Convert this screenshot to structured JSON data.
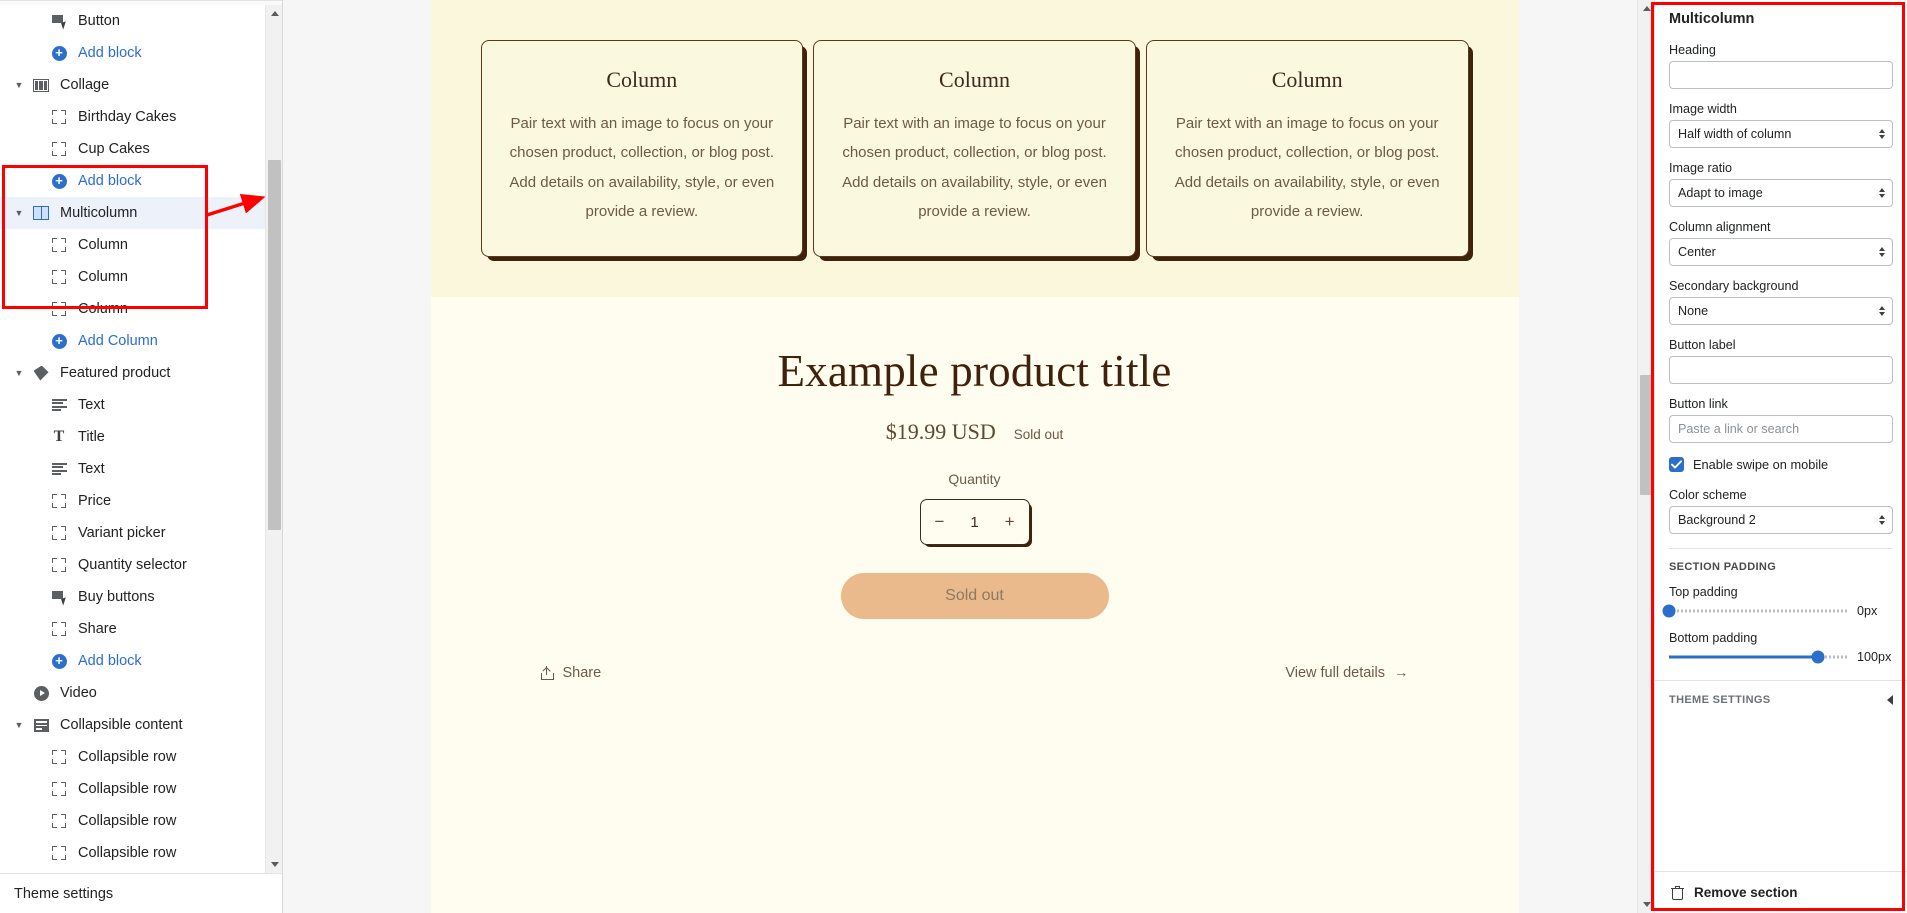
{
  "sidebar": {
    "tree": [
      {
        "label": "Button",
        "icon": "cursor-icon",
        "indent": 1,
        "caret": false,
        "type": "block"
      },
      {
        "label": "Add block",
        "icon": "plus-circle-icon",
        "indent": 1,
        "caret": false,
        "type": "action"
      },
      {
        "label": "Collage",
        "icon": "collage-icon",
        "indent": 0,
        "caret": true,
        "type": "section"
      },
      {
        "label": "Birthday Cakes",
        "icon": "block-icon",
        "indent": 1,
        "caret": false,
        "type": "block"
      },
      {
        "label": "Cup Cakes",
        "icon": "block-icon",
        "indent": 1,
        "caret": false,
        "type": "block"
      },
      {
        "label": "Add block",
        "icon": "plus-circle-icon",
        "indent": 1,
        "caret": false,
        "type": "action"
      },
      {
        "label": "Multicolumn",
        "icon": "multicolumn-icon",
        "indent": 0,
        "caret": true,
        "type": "section",
        "selected": true
      },
      {
        "label": "Column",
        "icon": "block-icon",
        "indent": 1,
        "caret": false,
        "type": "block"
      },
      {
        "label": "Column",
        "icon": "block-icon",
        "indent": 1,
        "caret": false,
        "type": "block"
      },
      {
        "label": "Column",
        "icon": "block-icon",
        "indent": 1,
        "caret": false,
        "type": "block"
      },
      {
        "label": "Add Column",
        "icon": "plus-circle-icon",
        "indent": 1,
        "caret": false,
        "type": "action"
      },
      {
        "label": "Featured product",
        "icon": "tag-icon",
        "indent": 0,
        "caret": true,
        "type": "section"
      },
      {
        "label": "Text",
        "icon": "text-icon",
        "indent": 1,
        "caret": false,
        "type": "block"
      },
      {
        "label": "Title",
        "icon": "title-icon",
        "indent": 1,
        "caret": false,
        "type": "block"
      },
      {
        "label": "Text",
        "icon": "text-icon",
        "indent": 1,
        "caret": false,
        "type": "block"
      },
      {
        "label": "Price",
        "icon": "block-icon",
        "indent": 1,
        "caret": false,
        "type": "block"
      },
      {
        "label": "Variant picker",
        "icon": "block-icon",
        "indent": 1,
        "caret": false,
        "type": "block"
      },
      {
        "label": "Quantity selector",
        "icon": "block-icon",
        "indent": 1,
        "caret": false,
        "type": "block"
      },
      {
        "label": "Buy buttons",
        "icon": "cursor-icon",
        "indent": 1,
        "caret": false,
        "type": "block"
      },
      {
        "label": "Share",
        "icon": "block-icon",
        "indent": 1,
        "caret": false,
        "type": "block"
      },
      {
        "label": "Add block",
        "icon": "plus-circle-icon",
        "indent": 1,
        "caret": false,
        "type": "action"
      },
      {
        "label": "Video",
        "icon": "video-icon",
        "indent": 0,
        "caret": false,
        "type": "section"
      },
      {
        "label": "Collapsible content",
        "icon": "collapsible-icon",
        "indent": 0,
        "caret": true,
        "type": "section"
      },
      {
        "label": "Collapsible row",
        "icon": "block-icon",
        "indent": 1,
        "caret": false,
        "type": "block"
      },
      {
        "label": "Collapsible row",
        "icon": "block-icon",
        "indent": 1,
        "caret": false,
        "type": "block"
      },
      {
        "label": "Collapsible row",
        "icon": "block-icon",
        "indent": 1,
        "caret": false,
        "type": "block"
      },
      {
        "label": "Collapsible row",
        "icon": "block-icon",
        "indent": 1,
        "caret": false,
        "type": "block"
      }
    ],
    "footer_label": "Theme settings"
  },
  "preview": {
    "multicolumn": {
      "columns": [
        {
          "title": "Column",
          "body": "Pair text with an image to focus on your chosen product, collection, or blog post. Add details on availability, style, or even provide a review."
        },
        {
          "title": "Column",
          "body": "Pair text with an image to focus on your chosen product, collection, or blog post. Add details on availability, style, or even provide a review."
        },
        {
          "title": "Column",
          "body": "Pair text with an image to focus on your chosen product, collection, or blog post. Add details on availability, style, or even provide a review."
        }
      ]
    },
    "product": {
      "title": "Example product title",
      "price": "$19.99 USD",
      "availability": "Sold out",
      "quantity_label": "Quantity",
      "quantity_value": "1",
      "quantity_minus": "−",
      "quantity_plus": "+",
      "buy_button_label": "Sold out",
      "share_label": "Share",
      "details_label": "View full details",
      "details_arrow": "→"
    }
  },
  "settings": {
    "panel_title": "Multicolumn",
    "fields": {
      "heading": {
        "label": "Heading",
        "value": ""
      },
      "image_width": {
        "label": "Image width",
        "value": "Half width of column"
      },
      "image_ratio": {
        "label": "Image ratio",
        "value": "Adapt to image"
      },
      "column_alignment": {
        "label": "Column alignment",
        "value": "Center"
      },
      "secondary_background": {
        "label": "Secondary background",
        "value": "None"
      },
      "button_label": {
        "label": "Button label",
        "value": ""
      },
      "button_link": {
        "label": "Button link",
        "placeholder": "Paste a link or search",
        "value": ""
      },
      "enable_swipe": {
        "label": "Enable swipe on mobile",
        "checked": true
      },
      "color_scheme": {
        "label": "Color scheme",
        "value": "Background 2"
      }
    },
    "section_padding": {
      "caption": "SECTION PADDING",
      "top": {
        "label": "Top padding",
        "value": "0px",
        "percent": 0
      },
      "bottom": {
        "label": "Bottom padding",
        "value": "100px",
        "percent": 83
      }
    },
    "theme_settings_caption": "THEME SETTINGS",
    "remove_section_label": "Remove section"
  },
  "colors": {
    "accent_blue": "#2c6ecb",
    "annotation_red": "#ff0000",
    "preview_bg": "#fffdf0",
    "multicolumn_bg": "#faf7dc",
    "card_bg": "#fbf8e0",
    "card_border": "#5b3a1a",
    "button_bg": "#eab98c",
    "selected_row_bg": "#edf2fa"
  }
}
